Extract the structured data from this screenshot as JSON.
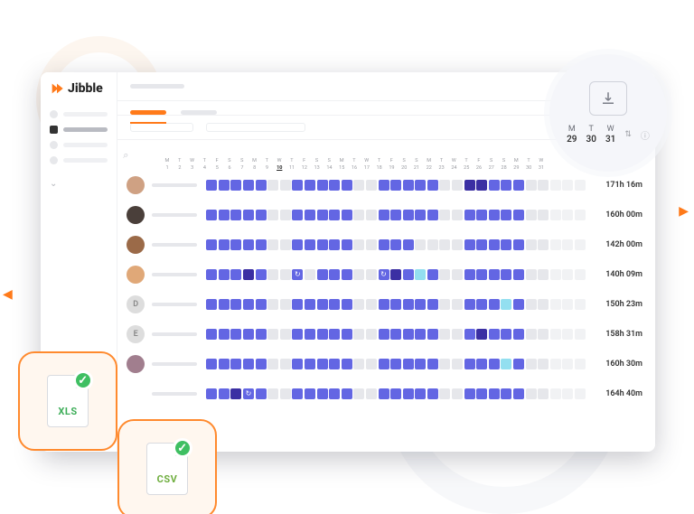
{
  "brand": {
    "name": "Jibble"
  },
  "sidebar": {
    "items": [
      {
        "active": false
      },
      {
        "active": true
      },
      {
        "active": false
      },
      {
        "active": false
      }
    ]
  },
  "calendar": {
    "weekdays": [
      "M",
      "T",
      "W",
      "T",
      "F",
      "S",
      "S",
      "M",
      "T",
      "W",
      "T",
      "F",
      "S",
      "S",
      "M",
      "T",
      "W",
      "T",
      "F",
      "S",
      "S",
      "M",
      "T",
      "W",
      "T",
      "F",
      "S",
      "S",
      "M",
      "T",
      "W"
    ],
    "dates": [
      "1",
      "2",
      "3",
      "4",
      "5",
      "6",
      "7",
      "8",
      "9",
      "10",
      "11",
      "12",
      "13",
      "14",
      "15",
      "16",
      "17",
      "18",
      "19",
      "20",
      "21",
      "22",
      "23",
      "24",
      "25",
      "26",
      "27",
      "28",
      "29",
      "30",
      "31"
    ],
    "current_index": 9
  },
  "rows": [
    {
      "avatar": "img1",
      "initial": "",
      "total": "171h 16m",
      "cells": [
        "W",
        "W",
        "W",
        "W",
        "W",
        "O",
        "O",
        "W",
        "W",
        "W",
        "W",
        "W",
        "O",
        "O",
        "W",
        "W",
        "W",
        "W",
        "W",
        "O",
        "O",
        "D",
        "D",
        "W",
        "W",
        "W",
        "O",
        "O",
        "G",
        "G",
        "G"
      ]
    },
    {
      "avatar": "img2",
      "initial": "",
      "total": "160h 00m",
      "cells": [
        "W",
        "W",
        "W",
        "W",
        "W",
        "O",
        "O",
        "W",
        "W",
        "W",
        "W",
        "W",
        "O",
        "O",
        "W",
        "W",
        "W",
        "W",
        "W",
        "O",
        "O",
        "W",
        "W",
        "W",
        "W",
        "W",
        "O",
        "O",
        "G",
        "G",
        "G"
      ]
    },
    {
      "avatar": "img3",
      "initial": "",
      "total": "142h 00m",
      "cells": [
        "W",
        "W",
        "W",
        "W",
        "W",
        "O",
        "O",
        "W",
        "W",
        "W",
        "W",
        "W",
        "O",
        "O",
        "W",
        "W",
        "W",
        "O",
        "O",
        "O",
        "O",
        "W",
        "W",
        "W",
        "W",
        "W",
        "O",
        "O",
        "G",
        "G",
        "G"
      ]
    },
    {
      "avatar": "img4",
      "initial": "",
      "total": "140h 09m",
      "cells": [
        "W",
        "W",
        "W",
        "D",
        "W",
        "O",
        "O",
        "H",
        "O",
        "W",
        "W",
        "W",
        "O",
        "O",
        "H",
        "D",
        "W",
        "L",
        "W",
        "O",
        "O",
        "W",
        "W",
        "W",
        "W",
        "W",
        "O",
        "O",
        "G",
        "G",
        "G"
      ]
    },
    {
      "avatar": "ltr",
      "initial": "D",
      "total": "150h 23m",
      "cells": [
        "W",
        "W",
        "W",
        "W",
        "W",
        "O",
        "O",
        "W",
        "W",
        "W",
        "W",
        "W",
        "O",
        "O",
        "W",
        "W",
        "W",
        "W",
        "W",
        "O",
        "O",
        "W",
        "W",
        "W",
        "L",
        "W",
        "O",
        "O",
        "G",
        "G",
        "G"
      ]
    },
    {
      "avatar": "ltr",
      "initial": "E",
      "total": "158h 31m",
      "cells": [
        "W",
        "W",
        "W",
        "W",
        "W",
        "O",
        "O",
        "W",
        "W",
        "W",
        "W",
        "W",
        "O",
        "O",
        "W",
        "W",
        "W",
        "W",
        "W",
        "O",
        "O",
        "W",
        "D",
        "W",
        "W",
        "W",
        "O",
        "O",
        "G",
        "G",
        "G"
      ]
    },
    {
      "avatar": "img7",
      "initial": "",
      "total": "160h 30m",
      "cells": [
        "W",
        "W",
        "W",
        "W",
        "W",
        "O",
        "O",
        "W",
        "W",
        "W",
        "W",
        "W",
        "O",
        "O",
        "W",
        "W",
        "W",
        "W",
        "W",
        "O",
        "O",
        "W",
        "W",
        "W",
        "L",
        "W",
        "O",
        "O",
        "G",
        "G",
        "G"
      ]
    },
    {
      "avatar": "none",
      "initial": "",
      "total": "164h 40m",
      "cells": [
        "W",
        "W",
        "D",
        "H",
        "W",
        "O",
        "O",
        "W",
        "W",
        "W",
        "W",
        "W",
        "O",
        "O",
        "W",
        "W",
        "W",
        "W",
        "W",
        "O",
        "O",
        "W",
        "W",
        "W",
        "W",
        "W",
        "O",
        "O",
        "G",
        "G",
        "G"
      ]
    }
  ],
  "export_bubble": {
    "cols": [
      {
        "label": "M",
        "date": "29"
      },
      {
        "label": "T",
        "date": "30"
      },
      {
        "label": "W",
        "date": "31"
      }
    ]
  },
  "file_badges": {
    "xls": "XLS",
    "csv": "CSV"
  }
}
